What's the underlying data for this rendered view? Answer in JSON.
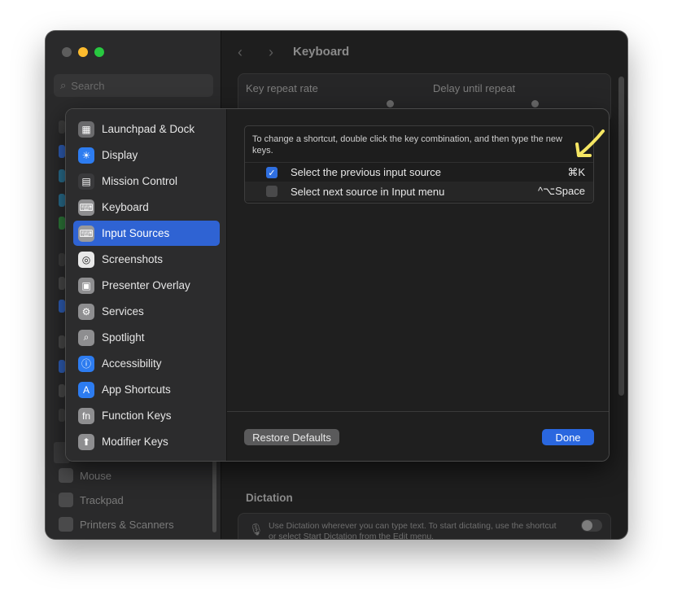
{
  "window": {
    "title": "Keyboard",
    "search_placeholder": "Search",
    "traffic_colors": [
      "#5d5d5d",
      "#febc2e",
      "#28c840"
    ]
  },
  "background": {
    "sidebar_items": [
      "Mouse",
      "Trackpad",
      "Printers & Scanners"
    ],
    "key_repeat_label": "Key repeat rate",
    "delay_label": "Delay until repeat",
    "dictation_title": "Dictation",
    "dictation_text_1": "Use Dictation wherever you can type text. To start dictating, use the shortcut",
    "dictation_text_2": "or select Start Dictation from the Edit menu."
  },
  "sheet": {
    "categories": [
      {
        "label": "Launchpad & Dock",
        "icon": "launchpad-icon",
        "color": "#6b6b6d",
        "glyph": "▦"
      },
      {
        "label": "Display",
        "icon": "display-icon",
        "color": "#2d7cf0",
        "glyph": "☀"
      },
      {
        "label": "Mission Control",
        "icon": "mission-control-icon",
        "color": "#3a3a3c",
        "glyph": "▤"
      },
      {
        "label": "Keyboard",
        "icon": "keyboard-icon",
        "color": "#8e8e90",
        "glyph": "⌨"
      },
      {
        "label": "Input Sources",
        "icon": "input-sources-icon",
        "color": "#9a9a9c",
        "glyph": "⌨"
      },
      {
        "label": "Screenshots",
        "icon": "screenshots-icon",
        "color": "#e8e8e8",
        "glyph": "◎"
      },
      {
        "label": "Presenter Overlay",
        "icon": "presenter-overlay-icon",
        "color": "#8e8e90",
        "glyph": "▣"
      },
      {
        "label": "Services",
        "icon": "services-icon",
        "color": "#8e8e90",
        "glyph": "⚙"
      },
      {
        "label": "Spotlight",
        "icon": "spotlight-icon",
        "color": "#8e8e90",
        "glyph": "⌕"
      },
      {
        "label": "Accessibility",
        "icon": "accessibility-icon",
        "color": "#2d7cf0",
        "glyph": "ⓘ"
      },
      {
        "label": "App Shortcuts",
        "icon": "app-shortcuts-icon",
        "color": "#2d7cf0",
        "glyph": "A"
      },
      {
        "label": "Function Keys",
        "icon": "function-keys-icon",
        "color": "#8e8e90",
        "glyph": "fn"
      },
      {
        "label": "Modifier Keys",
        "icon": "modifier-keys-icon",
        "color": "#8e8e90",
        "glyph": "⬆"
      }
    ],
    "selected_category": "Input Sources",
    "hint": "To change a shortcut, double click the key combination, and then type the new keys.",
    "shortcuts": [
      {
        "label": "Select the previous input source",
        "key": "⌘K",
        "checked": true
      },
      {
        "label": "Select next source in Input menu",
        "key": "^⌥Space",
        "checked": false
      }
    ],
    "restore_label": "Restore Defaults",
    "done_label": "Done"
  },
  "annotation": {
    "arrow_color": "#f5e663"
  }
}
